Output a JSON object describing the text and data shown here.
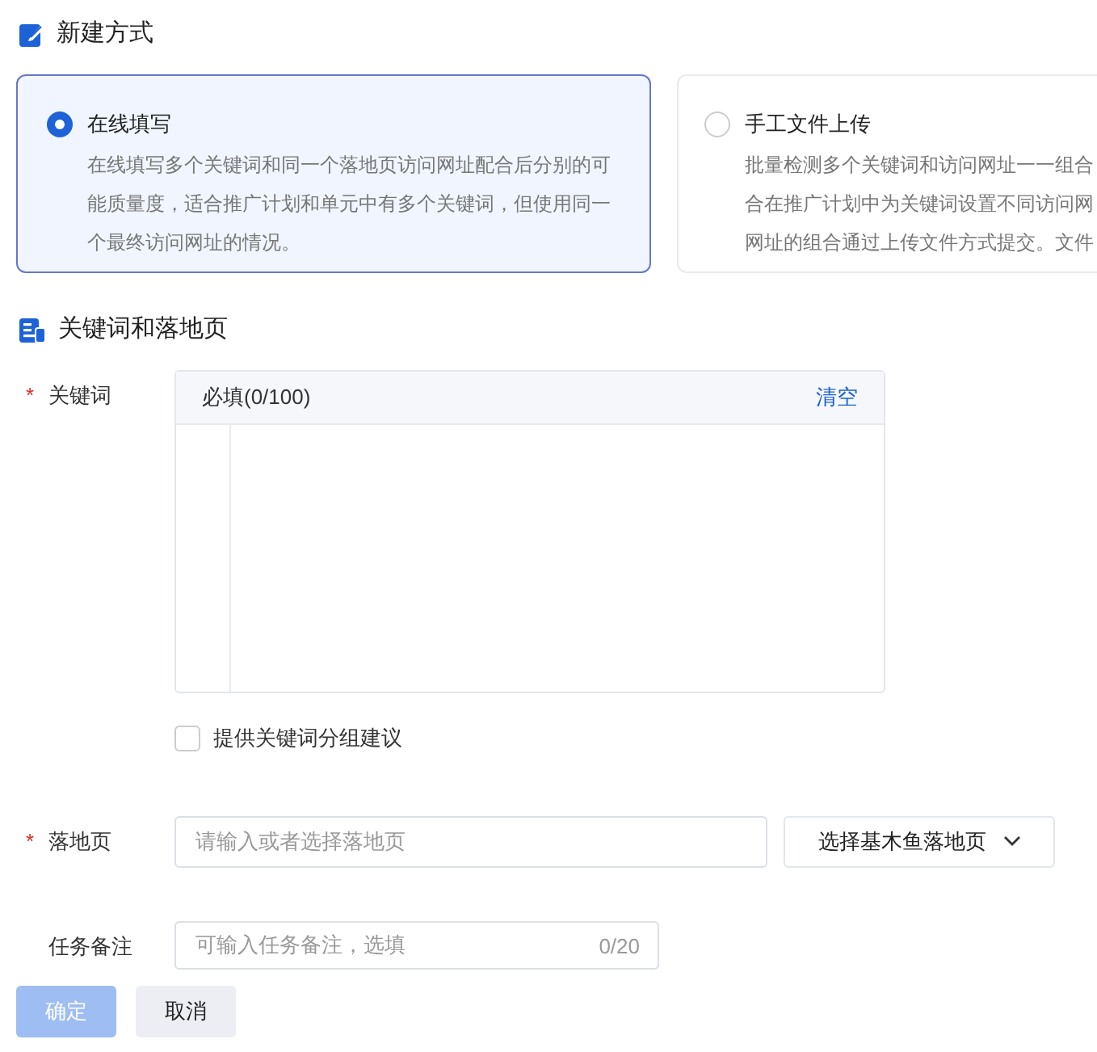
{
  "creation_method": {
    "title": "新建方式",
    "options": [
      {
        "label": "在线填写",
        "selected": true,
        "description_lines": [
          "在线填写多个关键词和同一个落地页访问网址配合后分别的可",
          "能质量度，适合推广计划和单元中有多个关键词，但使用同一",
          "个最终访问网址的情况。"
        ]
      },
      {
        "label": "手工文件上传",
        "selected": false,
        "description_lines": [
          "批量检测多个关键词和访问网址一一组合",
          "合在推广计划中为关键词设置不同访问网",
          "网址的组合通过上传文件方式提交。文件"
        ]
      }
    ]
  },
  "keywords_section": {
    "title": "关键词和落地页"
  },
  "keyword_field": {
    "label": "关键词",
    "required_mark": "*",
    "header": "必填(0/100)",
    "action": "清空"
  },
  "grouping_checkbox": {
    "label": "提供关键词分组建议",
    "checked": false
  },
  "landing_page": {
    "label": "落地页",
    "required_mark": "*",
    "placeholder": "请输入或者选择落地页",
    "select_button": "选择基木鱼落地页"
  },
  "task_note": {
    "label": "任务备注",
    "placeholder": "可输入任务备注，选填",
    "counter": "0/20"
  },
  "buttons": [
    {
      "label": "确定",
      "kind": "primary",
      "disabled": true
    },
    {
      "label": "取消",
      "kind": "secondary",
      "disabled": false
    }
  ]
}
